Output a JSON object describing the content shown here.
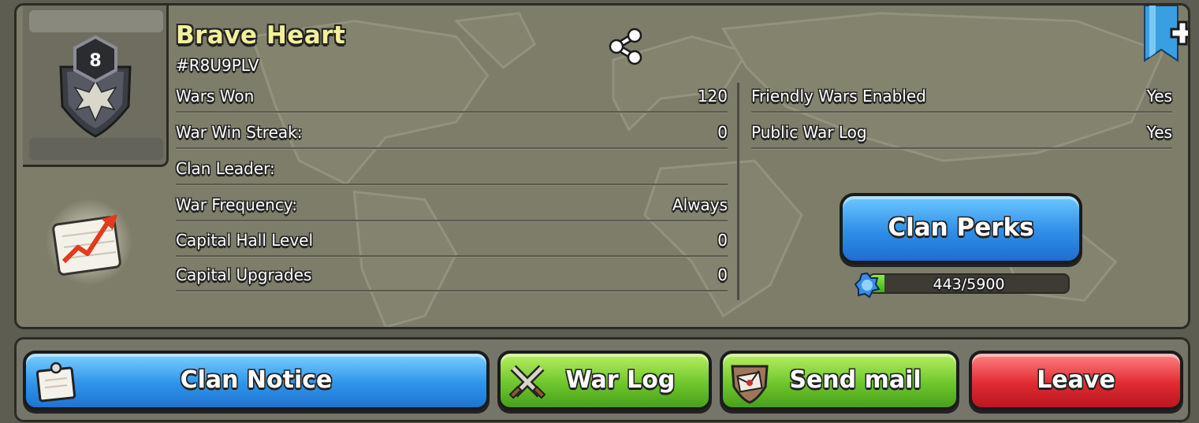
{
  "clan": {
    "name": "Brave Heart",
    "tag": "#R8U9PLV",
    "level": "8"
  },
  "stats_left": [
    {
      "label": "Wars Won",
      "value": "120"
    },
    {
      "label": "War Win Streak:",
      "value": "0"
    },
    {
      "label": "Clan Leader:",
      "value": ""
    },
    {
      "label": "War Frequency:",
      "value": "Always"
    },
    {
      "label": "Capital Hall Level",
      "value": "0"
    },
    {
      "label": "Capital Upgrades",
      "value": "0"
    }
  ],
  "stats_right": [
    {
      "label": "Friendly Wars Enabled",
      "value": "Yes"
    },
    {
      "label": "Public War Log",
      "value": "Yes"
    }
  ],
  "perks": {
    "button_label": "Clan Perks",
    "progress_text": "443/5900",
    "progress_current": 443,
    "progress_max": 5900
  },
  "toolbar": {
    "clan_notice": "Clan Notice",
    "war_log": "War Log",
    "send_mail": "Send mail",
    "leave": "Leave"
  },
  "colors": {
    "clan_name": "#f3ef9a",
    "blue_button": "#2f8ee9",
    "green_button": "#6ec72d",
    "red_button": "#e22b33"
  },
  "icons": [
    "clan-badge-icon",
    "stats-chart-icon",
    "share-icon",
    "bookmark-ribbon-icon",
    "gem-icon",
    "notepad-icon",
    "crossed-swords-icon",
    "mail-shield-icon"
  ]
}
